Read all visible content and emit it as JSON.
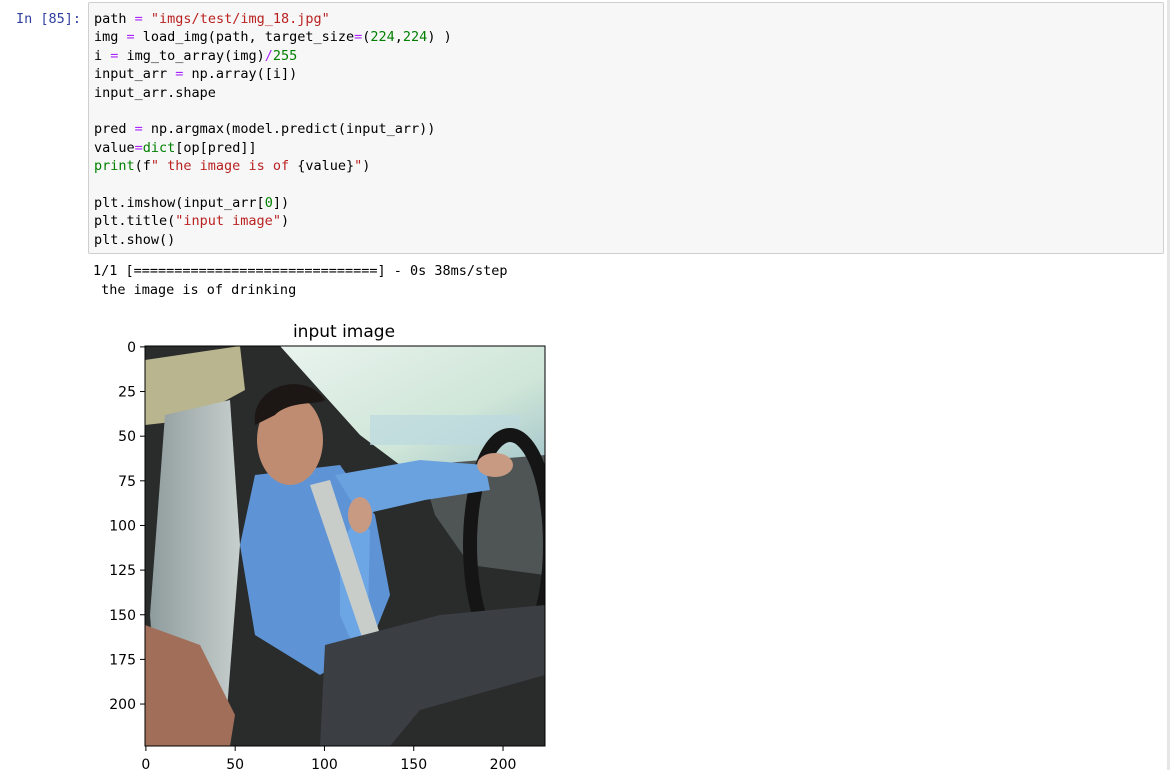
{
  "cell": {
    "prompt": "In [85]:",
    "code_lines": [
      "path = \"imgs/test/img_18.jpg\"",
      "img = load_img(path, target_size=(224,224) )",
      "i = img_to_array(img)/255",
      "input_arr = np.array([i])",
      "input_arr.shape",
      "",
      "pred = np.argmax(model.predict(input_arr))",
      "value=dict[op[pred]]",
      "print(f\" the image is of {value}\")",
      "",
      "plt.imshow(input_arr[0])",
      "plt.title(\"input image\")",
      "plt.show()"
    ]
  },
  "output": {
    "progress_line": "1/1 [==============================] - 0s 38ms/step",
    "result_line": " the image is of drinking"
  },
  "figure": {
    "title": "input image",
    "y_ticks": [
      "0",
      "25",
      "50",
      "75",
      "100",
      "125",
      "150",
      "175",
      "200"
    ],
    "x_ticks": [
      "0",
      "50",
      "100",
      "150",
      "200"
    ],
    "image_description_icon": "car-driver-photo"
  },
  "colors": {
    "prompt": "#303f9f",
    "string": "#ba2121",
    "operator": "#aa22ff",
    "number": "#008000",
    "cell_bg": "#f7f7f7",
    "cell_border": "#cfcfcf"
  }
}
